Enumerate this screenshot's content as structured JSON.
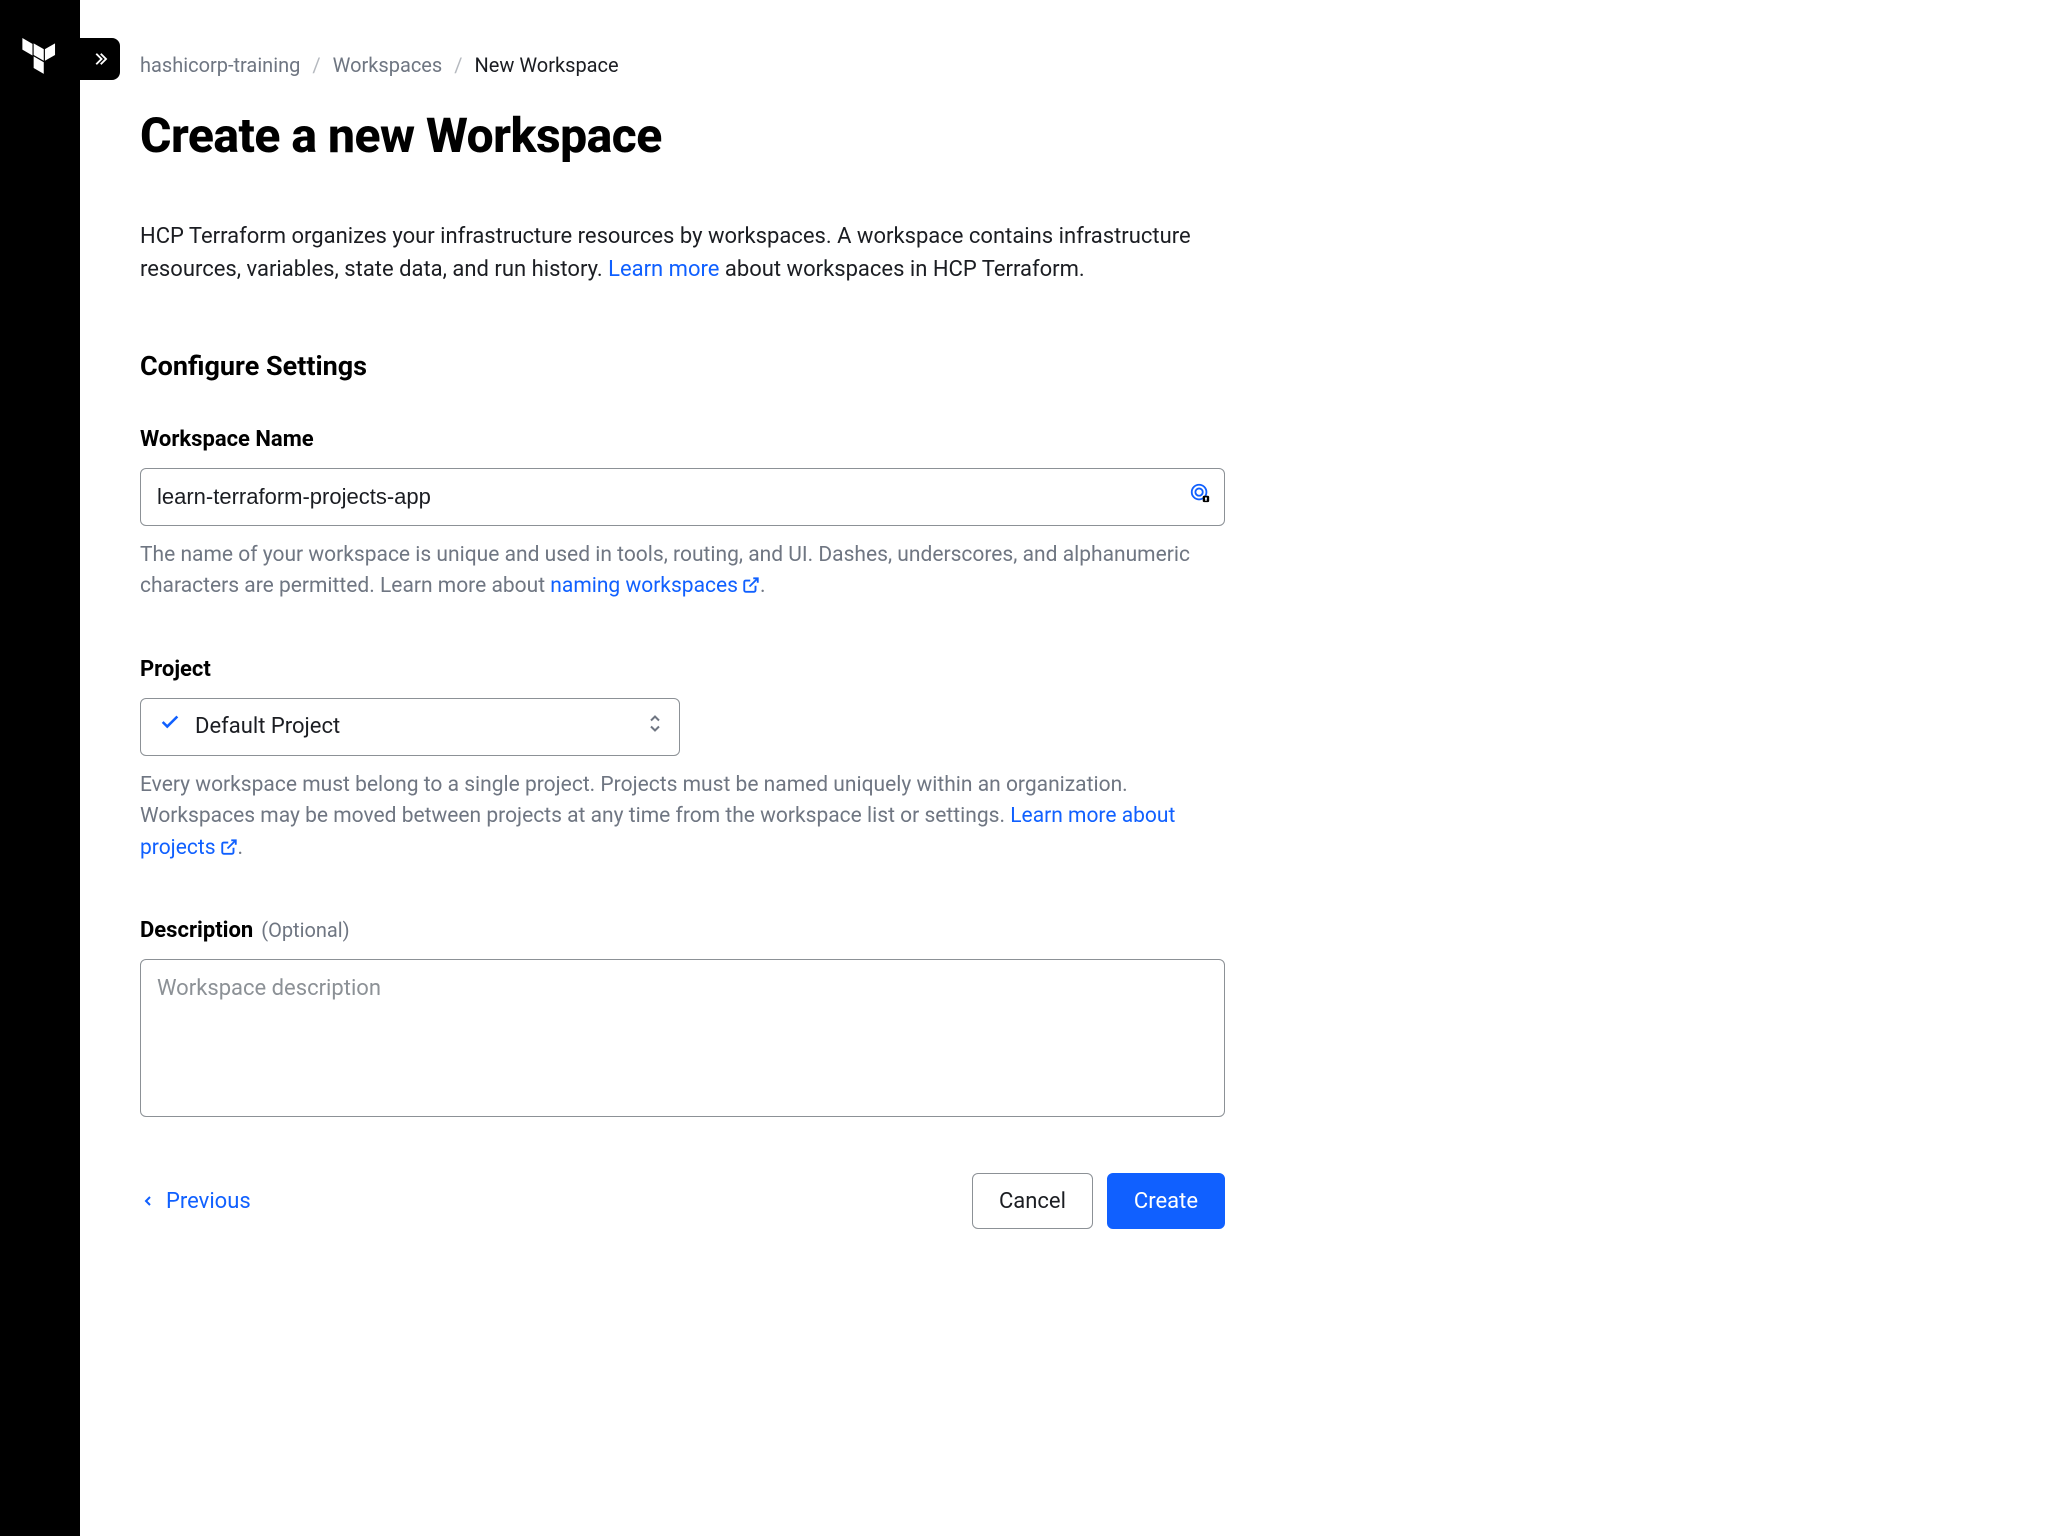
{
  "breadcrumb": {
    "org": "hashicorp-training",
    "section": "Workspaces",
    "current": "New Workspace"
  },
  "page": {
    "title": "Create a new Workspace",
    "intro_pre": "HCP Terraform organizes your infrastructure resources by workspaces. A workspace contains infrastructure resources, variables, state data, and run history. ",
    "intro_link": "Learn more",
    "intro_post": " about workspaces in HCP Terraform.",
    "section_heading": "Configure Settings"
  },
  "fields": {
    "name": {
      "label": "Workspace Name",
      "value": "learn-terraform-projects-app",
      "help_pre": "The name of your workspace is unique and used in tools, routing, and UI. Dashes, underscores, and alphanumeric characters are permitted. Learn more about ",
      "help_link": "naming workspaces",
      "help_post": "."
    },
    "project": {
      "label": "Project",
      "selected": "Default Project",
      "help_pre": "Every workspace must belong to a single project. Projects must be named uniquely within an organization. Workspaces may be moved between projects at any time from the workspace list or settings. ",
      "help_link": "Learn more about projects",
      "help_post": "."
    },
    "description": {
      "label": "Description",
      "optional": "(Optional)",
      "placeholder": "Workspace description",
      "value": ""
    }
  },
  "footer": {
    "previous": "Previous",
    "cancel": "Cancel",
    "create": "Create"
  }
}
